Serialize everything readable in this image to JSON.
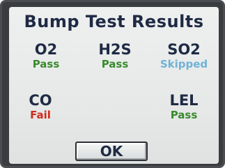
{
  "dialog": {
    "title": "Bump Test Results",
    "ok_label": "OK"
  },
  "gases": [
    {
      "name": "O2",
      "status": "Pass",
      "status_color": "#3a8a2e"
    },
    {
      "name": "H2S",
      "status": "Pass",
      "status_color": "#3a8a2e"
    },
    {
      "name": "SO2",
      "status": "Skipped",
      "status_color": "#6fb2d6"
    },
    {
      "name": "CO",
      "status": "Fail",
      "status_color": "#d22a1c"
    },
    {
      "name": "LEL",
      "status": "Pass",
      "status_color": "#3a8a2e"
    }
  ]
}
